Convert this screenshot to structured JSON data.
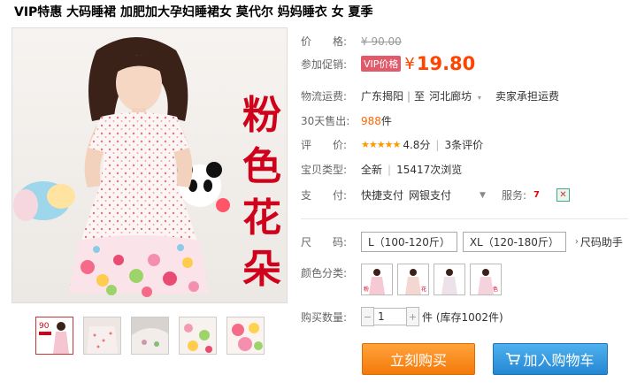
{
  "product": {
    "title": "VIP特惠 大码睡裙 加肥加大孕妇睡裙女 莫代尔 妈妈睡衣 女 夏季",
    "image_overlay_text": [
      "粉",
      "色",
      "花",
      "朵"
    ]
  },
  "price": {
    "label": "价　　格:",
    "original": "¥ 90.00",
    "promo_label": "参加促销:",
    "vip_tag": "VIP价格",
    "currency": "¥",
    "promo_price": "19.80"
  },
  "shipping": {
    "label": "物流运费:",
    "from": "广东揭阳",
    "sep": "|",
    "to_prefix": "至",
    "to": "河北廊坊",
    "note": "卖家承担运费"
  },
  "sales": {
    "label": "30天售出:",
    "count": "988",
    "unit": "件"
  },
  "rating": {
    "label": "评　　价:",
    "stars": "★★★★★",
    "score": "4.8分",
    "sep": "|",
    "reviews": "3条评价"
  },
  "item_type": {
    "label": "宝贝类型:",
    "condition": "全新",
    "sep": "|",
    "views": "15417次浏览"
  },
  "payment": {
    "label": "支　　付:",
    "methods": [
      "快捷支付",
      "网银支付"
    ],
    "service_label": "服务:"
  },
  "size": {
    "label": "尺　　码:",
    "options": [
      "L（100-120斤）",
      "XL（120-180斤）"
    ],
    "helper": "尺码助手"
  },
  "colors": {
    "label": "颜色分类:",
    "swatch_count_hint": [
      "swatch-1",
      "swatch-2",
      "swatch-3",
      "swatch-4"
    ]
  },
  "quantity": {
    "label": "购买数量:",
    "value": "1",
    "stock": "件 (库存1002件)"
  },
  "actions": {
    "buy_now": "立刻购买",
    "add_cart": "加入购物车"
  },
  "theme": {
    "promo_color": "#ff4400",
    "buy_color": "#f47a0b",
    "cart_color": "#2487d3"
  }
}
